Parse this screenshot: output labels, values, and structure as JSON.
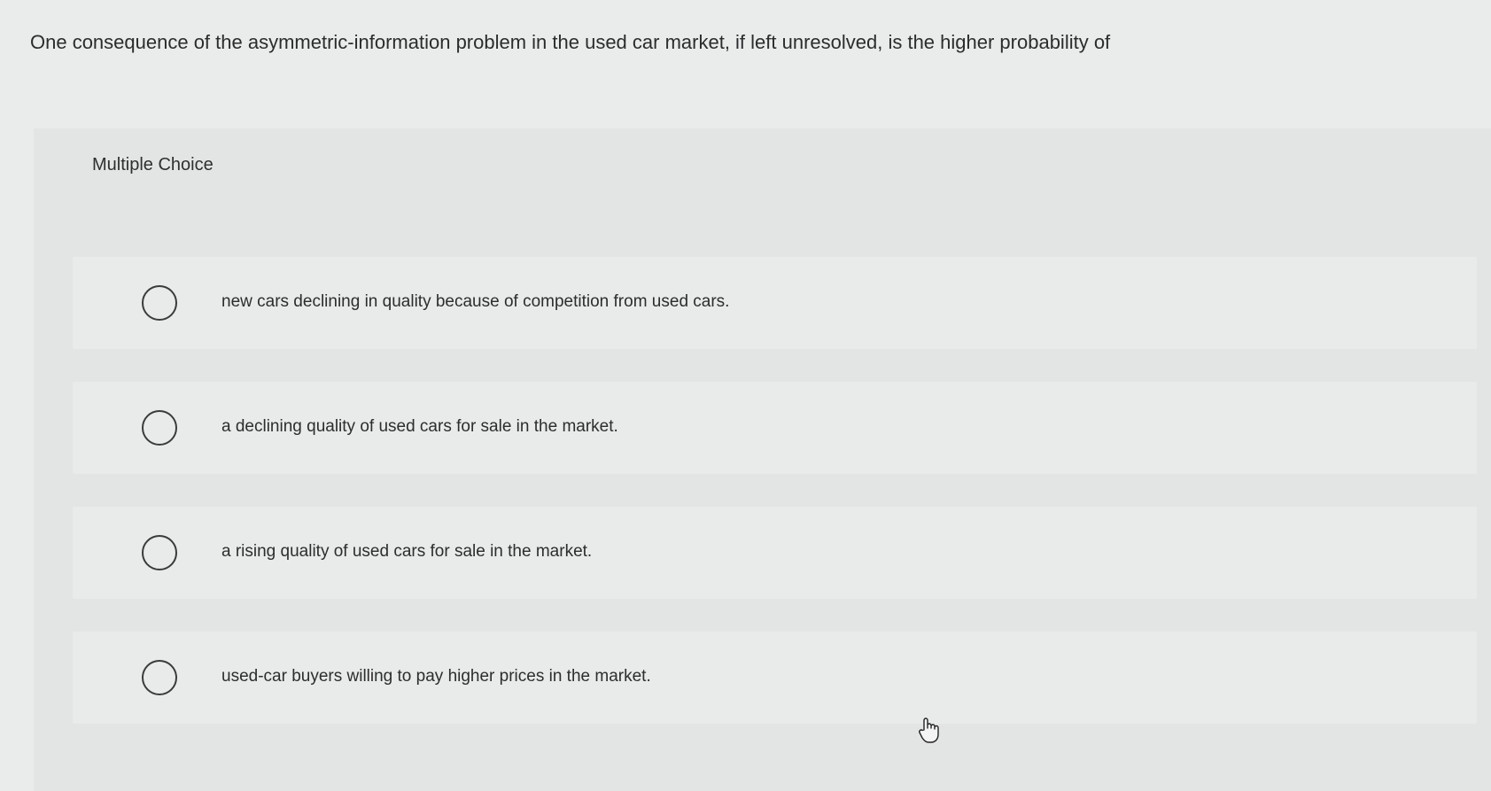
{
  "question": {
    "text": "One consequence of the asymmetric-information problem in the used car market, if left unresolved, is the higher probability of"
  },
  "multiple_choice": {
    "label": "Multiple Choice",
    "options": [
      {
        "text": "new cars declining in quality because of competition from used cars."
      },
      {
        "text": "a declining quality of used cars for sale in the market."
      },
      {
        "text": "a rising quality of used cars for sale in the market."
      },
      {
        "text": "used-car buyers willing to pay higher prices in the market."
      }
    ]
  },
  "cursor": {
    "icon": "hand-pointer-icon"
  }
}
